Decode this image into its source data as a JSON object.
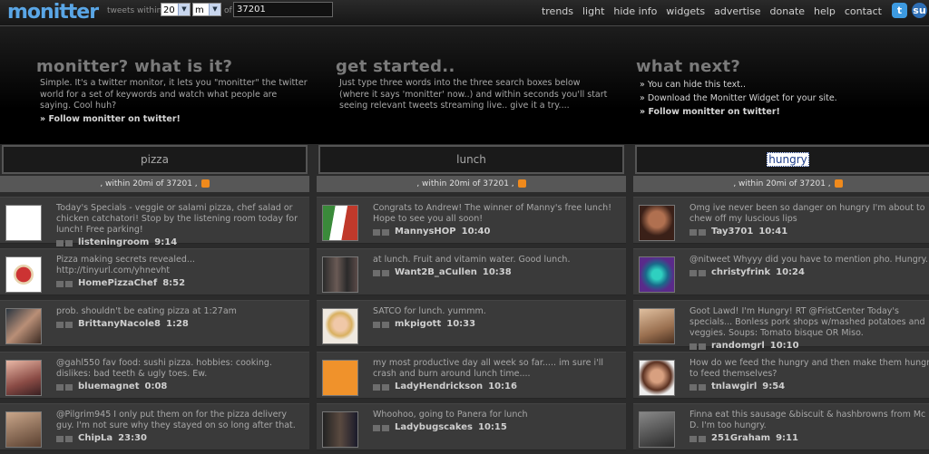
{
  "header": {
    "logo": "monitter",
    "tweets_within_label": "tweets within",
    "distance_value": "20",
    "unit_value": "m",
    "of_label": "of",
    "location_value": "37201",
    "nav": [
      "trends",
      "light",
      "hide info",
      "widgets",
      "advertise",
      "donate",
      "help",
      "contact"
    ],
    "twitter_icon": "twitter-icon",
    "stumbleupon_icon": "stumbleupon-icon"
  },
  "intro": {
    "what_title": "monitter? what is it?",
    "what_text": "Simple. It's a twitter monitor, it lets you \"monitter\" the twitter world for a set of keywords and watch what people are saying. Cool huh?",
    "what_link": "Follow monitter on twitter!",
    "start_title": "get started..",
    "start_text": "Just type three words into the three search boxes below (where it says 'monitter' now..) and within seconds you'll start seeing relevant tweets streaming live.. give it a try....",
    "next_title": "what next?",
    "next_line1": "You can hide this text..",
    "next_line2": "Download the Monitter Widget for your site.",
    "next_line3": "Follow monitter on twitter!"
  },
  "columns": [
    {
      "keyword": "pizza",
      "sub": ", within 20mi of 37201 ,",
      "tweets": [
        {
          "text": "Today's Specials - veggie or salami pizza, chef salad or chicken catchatori! Stop by the listening room today for lunch! Free parking!",
          "user": "listeningroom",
          "time": "9:14"
        },
        {
          "text": "Pizza making secrets revealed... http://tinyurl.com/yhnevht",
          "user": "HomePizzaChef",
          "time": "8:52"
        },
        {
          "text": "prob. shouldn't be eating pizza at 1:27am",
          "user": "BrittanyNacole8",
          "time": "1:28"
        },
        {
          "text": "@gahl550 fav food: sushi pizza. hobbies: cooking. dislikes: bad teeth & ugly toes. Ew.",
          "user": "bluemagnet",
          "time": "0:08"
        },
        {
          "text": "@Pilgrim945 I only put them on for the pizza delivery guy. I'm not sure why they stayed on so long after that.",
          "user": "ChipLa",
          "time": "23:30"
        }
      ]
    },
    {
      "keyword": "lunch",
      "sub": ", within 20mi of 37201 ,",
      "tweets": [
        {
          "text": "Congrats to Andrew! The winner of Manny's free lunch! Hope to see you all soon!",
          "user": "MannysHOP",
          "time": "10:40"
        },
        {
          "text": "at lunch. Fruit and vitamin water. Good lunch.",
          "user": "Want2B_aCullen",
          "time": "10:38"
        },
        {
          "text": "SATCO for lunch. yummm.",
          "user": "mkpigott",
          "time": "10:33"
        },
        {
          "text": "my most productive day all week so far..... im sure i'll crash and burn around lunch time....",
          "user": "LadyHendrickson",
          "time": "10:16"
        },
        {
          "text": "Whoohoo, going to Panera for lunch",
          "user": "Ladybugscakes",
          "time": "10:15"
        }
      ]
    },
    {
      "keyword": "hungry",
      "sub": ", within 20mi of 37201 ,",
      "tweets": [
        {
          "text": "Omg ive never been so danger on hungry I'm about to chew off my luscious lips",
          "user": "Tay3701",
          "time": "10:41"
        },
        {
          "text": "@nitweet Whyyy did you have to mention pho. Hungry.",
          "user": "christyfrink",
          "time": "10:24"
        },
        {
          "text": "Goot Lawd! I'm Hungry! RT @FristCenter Today's specials... Bonless pork shops w/mashed potatoes and veggies. Soups: Tomato bisque OR Miso.",
          "user": "randomgrl",
          "time": "10:10"
        },
        {
          "text": "How do we feed the hungry and then make them hungry to feed themselves?",
          "user": "tnlawgirl",
          "time": "9:54"
        },
        {
          "text": "Finna eat this sausage &biscuit & hashbrowns from Mc D. I'm too hungry.",
          "user": "251Graham",
          "time": "9:11"
        }
      ]
    }
  ]
}
